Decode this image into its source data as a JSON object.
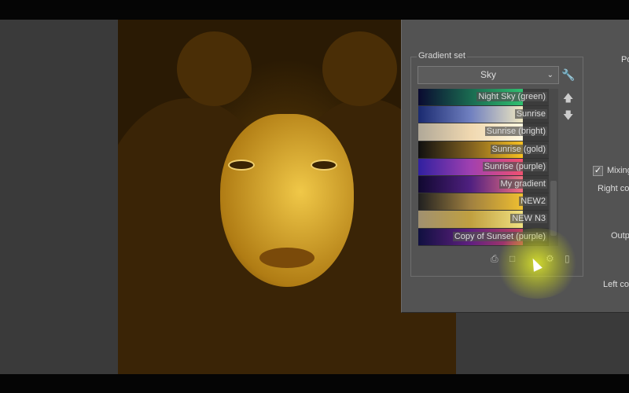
{
  "gradient_set": {
    "label": "Gradient set",
    "selected": "Sky",
    "items": [
      {
        "label": "Night Sky (green)",
        "colors": [
          "#0a0a30",
          "#1a6a50",
          "#30c070"
        ]
      },
      {
        "label": "Sunrise",
        "colors": [
          "#1a2a70",
          "#7080c0",
          "#f0e8c0"
        ]
      },
      {
        "label": "Sunrise (bright)",
        "colors": [
          "#b0a898",
          "#f0d8b0",
          "#fff8e0"
        ]
      },
      {
        "label": "Sunrise (gold)",
        "colors": [
          "#101010",
          "#806020",
          "#f8c020"
        ]
      },
      {
        "label": "Sunrise (purple)",
        "colors": [
          "#3020a0",
          "#a040b0",
          "#f05070"
        ]
      },
      {
        "label": "My gradient",
        "colors": [
          "#100830",
          "#502080",
          "#f07080"
        ]
      },
      {
        "label": "NEW2",
        "colors": [
          "#202020",
          "#a08040",
          "#f0c030"
        ]
      },
      {
        "label": "NEW N3",
        "colors": [
          "#a09070",
          "#c0a040",
          "#f0e080"
        ]
      },
      {
        "label": "Copy of Sunset (purple)",
        "colors": [
          "#101040",
          "#602080",
          "#c04060"
        ]
      }
    ]
  },
  "right_panel": {
    "po": "Po",
    "mixing": "Mixing",
    "mixing_checked": true,
    "right_color": "Right colo",
    "output": "Outpu",
    "left_color": "Left colo"
  }
}
